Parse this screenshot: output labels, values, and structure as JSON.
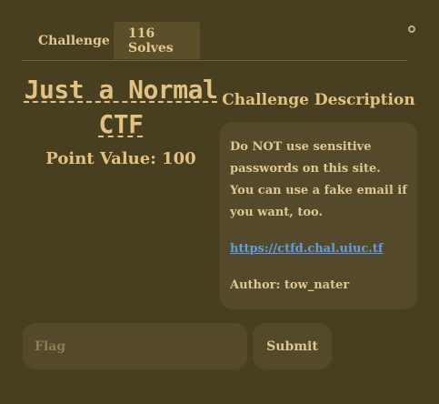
{
  "tabs": {
    "challenge_label": "Challenge",
    "solves_label": "116 Solves"
  },
  "challenge": {
    "title": "Just a Normal CTF",
    "point_value": "Point Value: 100"
  },
  "description": {
    "heading": "Challenge Description",
    "body": "Do NOT use sensitive passwords on this site. You can use a fake email if you want, too.",
    "link": "https://ctfd.chal.uiuc.tf",
    "author": "Author: tow_nater"
  },
  "form": {
    "flag_placeholder": "Flag",
    "submit_label": "Submit"
  },
  "colors": {
    "background": "#483e20",
    "panel": "#54492a",
    "accent_text": "#e3c182",
    "link": "#5e9ee6"
  },
  "icons": {
    "close": "close-icon"
  }
}
